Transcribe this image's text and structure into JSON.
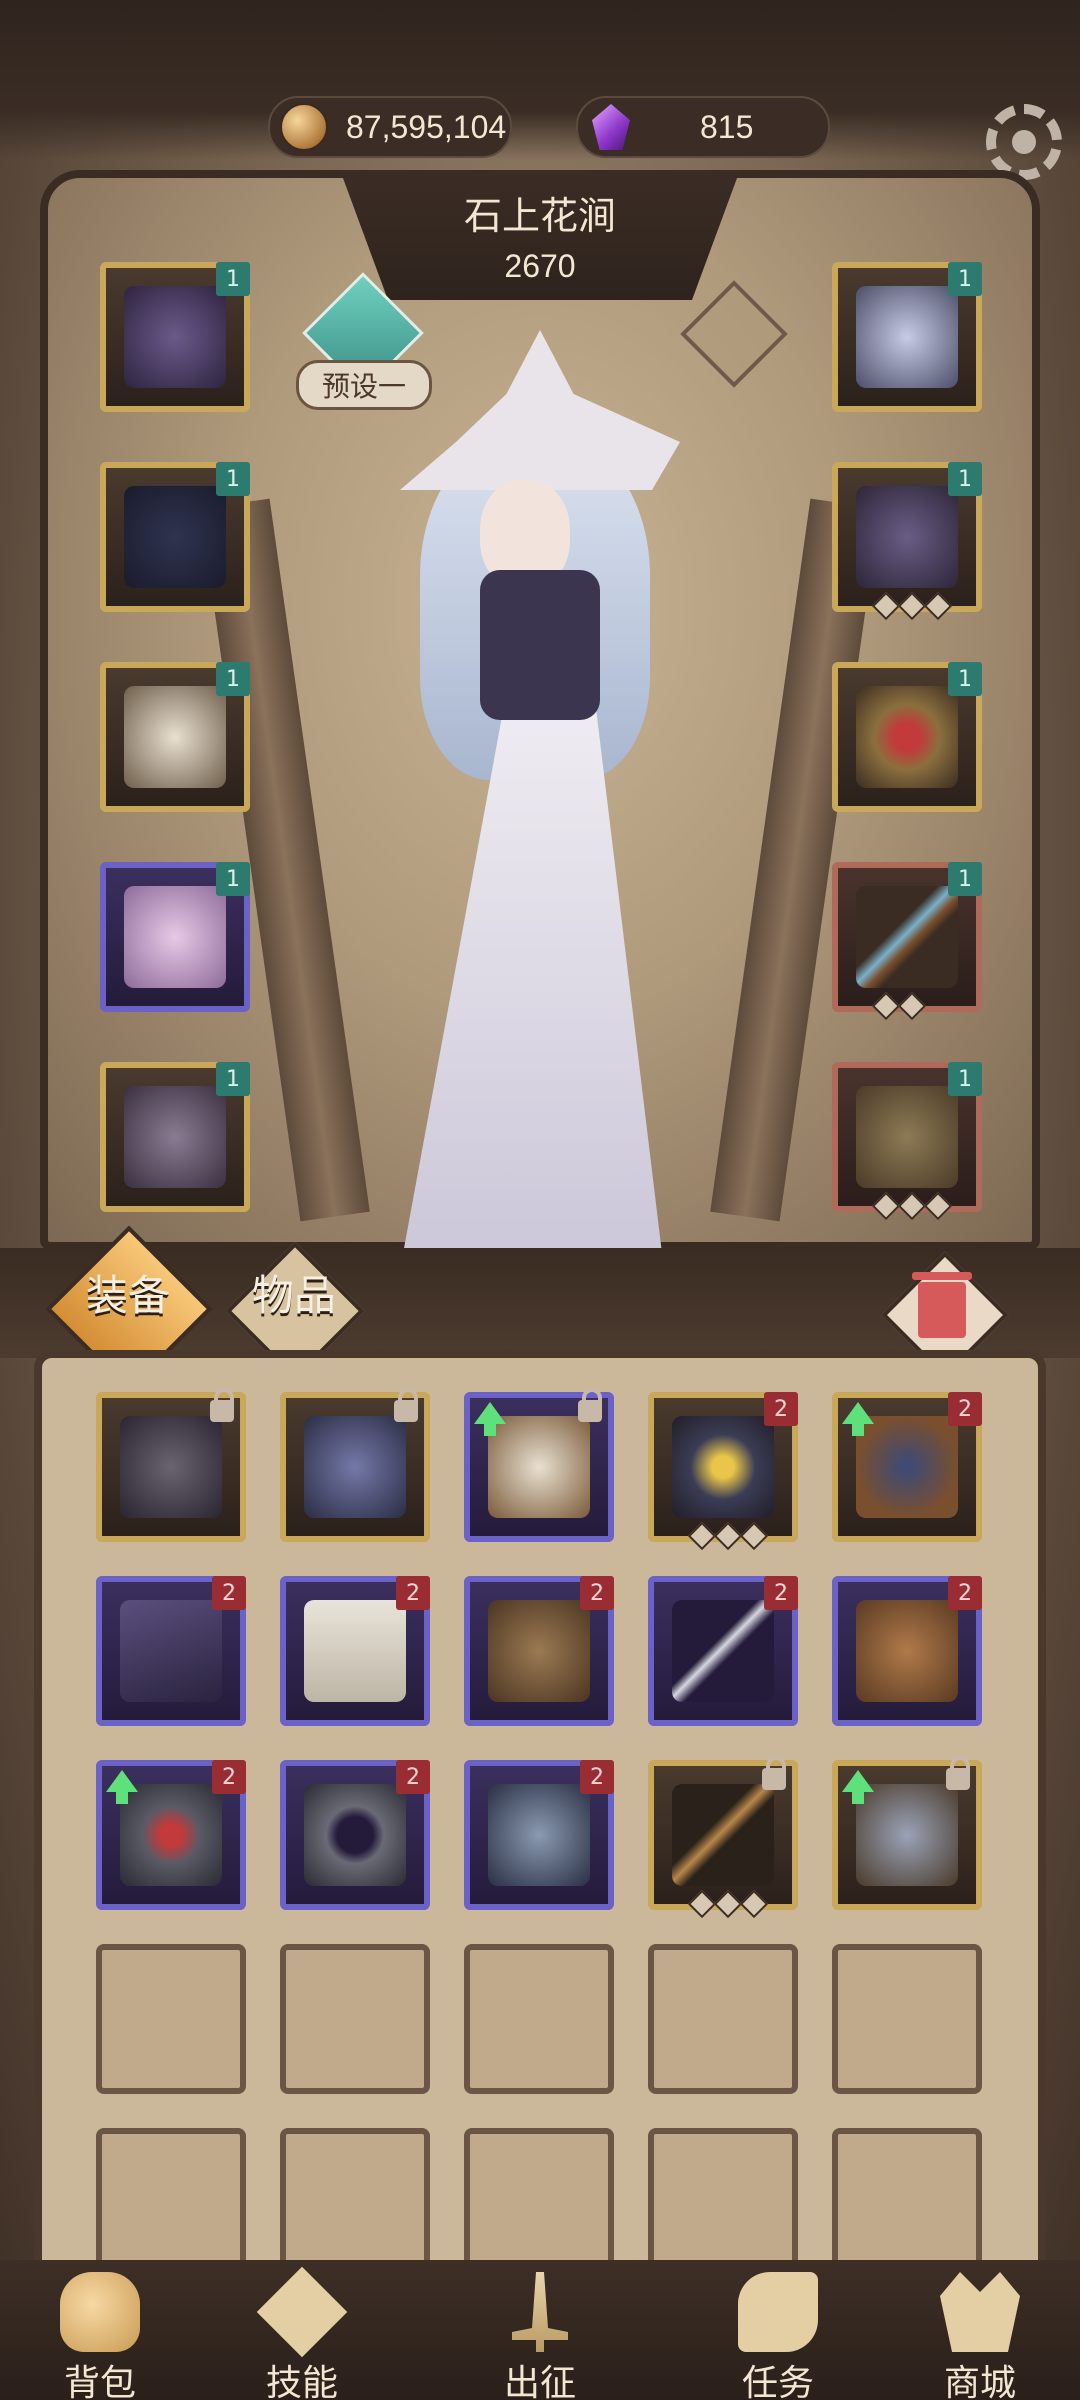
{
  "currency": {
    "gold": "87,595,104",
    "gems": "815"
  },
  "character": {
    "name": "石上花涧",
    "power": "2670",
    "preset_label": "预设一"
  },
  "tabs": {
    "equip": "装备",
    "items": "物品"
  },
  "nav": {
    "bag": "背包",
    "skills": "技能",
    "battle": "出征",
    "quests": "任务",
    "shop": "商城"
  },
  "equipped_slot_tag": "1",
  "inventory_level_tag": "2",
  "colors": {
    "gold_frame": "#c9a85a",
    "purple_frame": "#6a62c7",
    "red_frame": "#b06a5a",
    "teal_tag": "#2d7a6e",
    "red_tag": "#9a2c34"
  }
}
